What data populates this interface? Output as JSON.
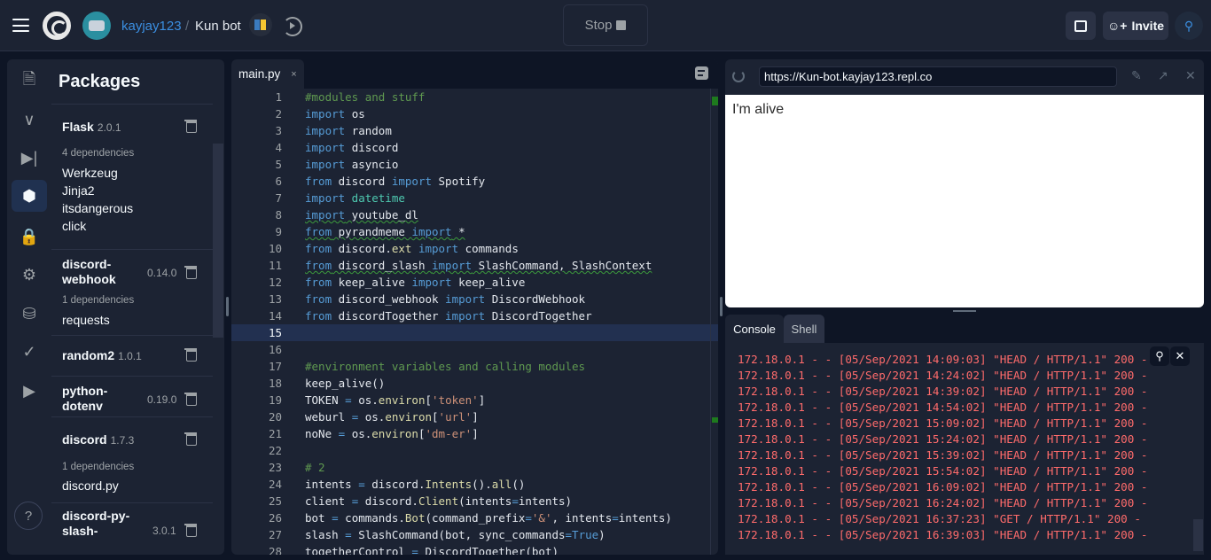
{
  "header": {
    "username": "kayjay123",
    "separator": "/",
    "repl_name": "Kun bot",
    "stop_label": "Stop",
    "invite_label": "Invite",
    "language_icon": "python-icon",
    "accent_color": "#3b8ee0"
  },
  "sidebar": {
    "icons": [
      "file-icon",
      "share-icon",
      "debugger-icon",
      "packages-icon",
      "lock-icon",
      "gear-icon",
      "database-icon",
      "check-icon",
      "youtube-icon"
    ],
    "help_label": "?"
  },
  "packages": {
    "title": "Packages",
    "items": [
      {
        "name": "Flask",
        "version": "2.0.1",
        "dep_count": "4 dependencies",
        "deps": [
          "Werkzeug",
          "Jinja2",
          "itsdangerous",
          "click"
        ]
      },
      {
        "name": "discord-webhook",
        "version": "0.14.0",
        "dep_count": "1 dependencies",
        "deps": [
          "requests"
        ]
      },
      {
        "name": "random2",
        "version": "1.0.1"
      },
      {
        "name": "python-dotenv",
        "version": "0.19.0"
      },
      {
        "name": "discord",
        "version": "1.7.3",
        "dep_count": "1 dependencies",
        "deps": [
          "discord.py"
        ]
      },
      {
        "name": "discord-py-slash-",
        "version": "3.0.1"
      }
    ]
  },
  "editor": {
    "tab_label": "main.py",
    "tab_close": "×",
    "current_line": 15,
    "lines": [
      [
        [
          "cm",
          "#modules and stuff"
        ]
      ],
      [
        [
          "kw",
          "import"
        ],
        [
          "",
          "os"
        ]
      ],
      [
        [
          "kw",
          "import"
        ],
        [
          "",
          "random"
        ]
      ],
      [
        [
          "kw",
          "import"
        ],
        [
          "",
          "discord"
        ]
      ],
      [
        [
          "kw",
          "import"
        ],
        [
          "",
          "asyncio"
        ]
      ],
      [
        [
          "kw",
          "from"
        ],
        [
          "",
          " discord "
        ],
        [
          "kw",
          "import"
        ],
        [
          "",
          " Spotify"
        ]
      ],
      [
        [
          "kw",
          "import"
        ],
        [
          "mod",
          " datetime"
        ]
      ],
      [
        [
          "kw~",
          "import"
        ],
        [
          "~",
          " youtube_dl"
        ]
      ],
      [
        [
          "kw~",
          "from"
        ],
        [
          "~",
          " pyrandmeme "
        ],
        [
          "kw~",
          "import"
        ],
        [
          "~",
          " *"
        ]
      ],
      [
        [
          "kw",
          "from"
        ],
        [
          "",
          " discord."
        ],
        [
          "fn",
          "ext"
        ],
        [
          "",
          " "
        ],
        [
          "kw",
          "import"
        ],
        [
          "",
          " commands"
        ]
      ],
      [
        [
          "kw~",
          "from"
        ],
        [
          "~",
          " discord_slash "
        ],
        [
          "kw~",
          "import"
        ],
        [
          "~",
          " SlashCommand, SlashContext"
        ]
      ],
      [
        [
          "kw",
          "from"
        ],
        [
          "",
          " keep_alive "
        ],
        [
          "kw",
          "import"
        ],
        [
          "",
          " keep_alive"
        ]
      ],
      [
        [
          "kw",
          "from"
        ],
        [
          "",
          " discord_webhook "
        ],
        [
          "kw",
          "import"
        ],
        [
          "",
          " DiscordWebhook"
        ]
      ],
      [
        [
          "kw",
          "from"
        ],
        [
          "",
          " discordTogether "
        ],
        [
          "kw",
          "import"
        ],
        [
          "",
          " DiscordTogether"
        ]
      ],
      [],
      [],
      [
        [
          "cm",
          "#environment variables and calling modules"
        ]
      ],
      [
        [
          "",
          "keep_alive()"
        ]
      ],
      [
        [
          "",
          "TOKEN "
        ],
        [
          "op",
          "="
        ],
        [
          "",
          " os."
        ],
        [
          "fn",
          "environ"
        ],
        [
          "",
          "["
        ],
        [
          "str",
          "'token'"
        ],
        [
          "",
          "]"
        ]
      ],
      [
        [
          "",
          "weburl "
        ],
        [
          "op",
          "="
        ],
        [
          "",
          " os."
        ],
        [
          "fn",
          "environ"
        ],
        [
          "",
          "["
        ],
        [
          "str",
          "'url'"
        ],
        [
          "",
          "]"
        ]
      ],
      [
        [
          "",
          "noNe "
        ],
        [
          "op",
          "="
        ],
        [
          "",
          " os."
        ],
        [
          "fn",
          "environ"
        ],
        [
          "",
          "["
        ],
        [
          "str",
          "'dm-er'"
        ],
        [
          "",
          "]"
        ]
      ],
      [],
      [
        [
          "cm",
          "# 2"
        ]
      ],
      [
        [
          "",
          "intents "
        ],
        [
          "op",
          "="
        ],
        [
          "",
          " discord."
        ],
        [
          "fn",
          "Intents"
        ],
        [
          "",
          "()."
        ],
        [
          "fn",
          "all"
        ],
        [
          "",
          "()"
        ]
      ],
      [
        [
          "",
          "client "
        ],
        [
          "op",
          "="
        ],
        [
          "",
          " discord."
        ],
        [
          "fn",
          "Client"
        ],
        [
          "",
          "(intents"
        ],
        [
          "op",
          "="
        ],
        [
          "",
          "intents)"
        ]
      ],
      [
        [
          "",
          "bot "
        ],
        [
          "op",
          "="
        ],
        [
          "",
          " commands."
        ],
        [
          "fn",
          "Bot"
        ],
        [
          "",
          "(command_prefix"
        ],
        [
          "op",
          "="
        ],
        [
          "str",
          "'&'"
        ],
        [
          "",
          ", intents"
        ],
        [
          "op",
          "="
        ],
        [
          "",
          "intents)"
        ]
      ],
      [
        [
          "",
          "slash "
        ],
        [
          "op",
          "="
        ],
        [
          "",
          " SlashCommand(bot, sync_commands"
        ],
        [
          "op",
          "="
        ],
        [
          "bool",
          "True"
        ],
        [
          "",
          ")"
        ]
      ],
      [
        [
          "",
          "togetherControl "
        ],
        [
          "op",
          "="
        ],
        [
          "",
          " DiscordTogether(bot)"
        ]
      ]
    ]
  },
  "webview": {
    "url": "https://Kun-bot.kayjay123.repl.co",
    "body_text": "I'm alive"
  },
  "console": {
    "tabs": [
      "Console",
      "Shell"
    ],
    "active_tab": "Console",
    "lines": [
      "172.18.0.1 - - [05/Sep/2021 14:09:03] \"HEAD / HTTP/1.1\" 200 -",
      "172.18.0.1 - - [05/Sep/2021 14:24:02] \"HEAD / HTTP/1.1\" 200 -",
      "172.18.0.1 - - [05/Sep/2021 14:39:02] \"HEAD / HTTP/1.1\" 200 -",
      "172.18.0.1 - - [05/Sep/2021 14:54:02] \"HEAD / HTTP/1.1\" 200 -",
      "172.18.0.1 - - [05/Sep/2021 15:09:02] \"HEAD / HTTP/1.1\" 200 -",
      "172.18.0.1 - - [05/Sep/2021 15:24:02] \"HEAD / HTTP/1.1\" 200 -",
      "172.18.0.1 - - [05/Sep/2021 15:39:02] \"HEAD / HTTP/1.1\" 200 -",
      "172.18.0.1 - - [05/Sep/2021 15:54:02] \"HEAD / HTTP/1.1\" 200 -",
      "172.18.0.1 - - [05/Sep/2021 16:09:02] \"HEAD / HTTP/1.1\" 200 -",
      "172.18.0.1 - - [05/Sep/2021 16:24:02] \"HEAD / HTTP/1.1\" 200 -",
      "172.18.0.1 - - [05/Sep/2021 16:37:23] \"GET / HTTP/1.1\" 200 -",
      "172.18.0.1 - - [05/Sep/2021 16:39:03] \"HEAD / HTTP/1.1\" 200 -"
    ],
    "log_color": "#ff6b6b"
  }
}
